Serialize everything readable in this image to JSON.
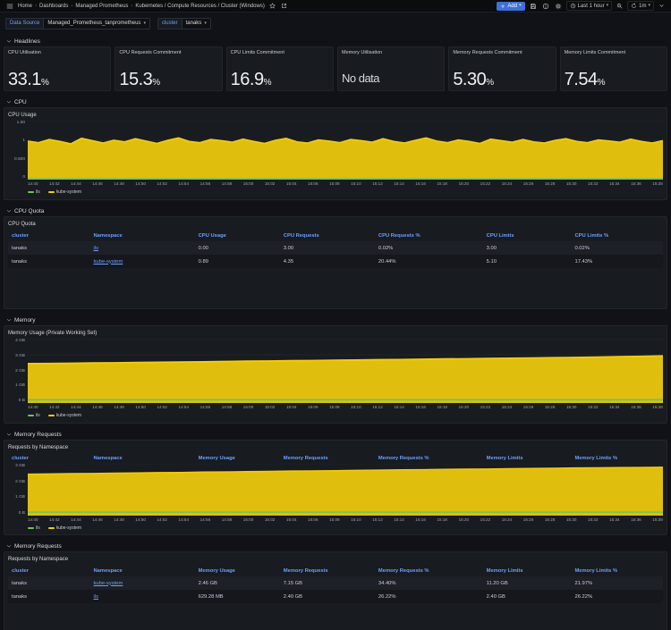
{
  "nav": {
    "breadcrumb": [
      "Home",
      "Dashboards",
      "Managed Prometheus",
      "Kubernetes / Compute Resources / Cluster (Windows)"
    ],
    "add_label": "Add",
    "time_range": "Last 1 hour",
    "refresh_interval": "1m"
  },
  "variables": {
    "datasource_label": "Data Source",
    "datasource_value": "Managed_Prometheus_tanprometheus",
    "cluster_label": "cluster",
    "cluster_value": "tanaks"
  },
  "sections": [
    "Headlines",
    "CPU",
    "CPU Quota",
    "Memory",
    "Memory Requests",
    "Memory Requests"
  ],
  "stats": [
    {
      "title": "CPU Utilisation",
      "value": "33.1",
      "unit": "%"
    },
    {
      "title": "CPU Requests Commitment",
      "value": "15.3",
      "unit": "%"
    },
    {
      "title": "CPU Limits Commitment",
      "value": "16.9",
      "unit": "%"
    },
    {
      "title": "Memory Utilisation",
      "value": "No data",
      "unit": ""
    },
    {
      "title": "Memory Requests Commitment",
      "value": "5.30",
      "unit": "%"
    },
    {
      "title": "Memory Limits Commitment",
      "value": "7.54",
      "unit": "%"
    }
  ],
  "chart_data": [
    {
      "type": "area",
      "title": "CPU Usage",
      "ymax": 1.5,
      "yticks": [
        "1.50",
        "1",
        "0.500",
        "0"
      ],
      "grid_values": [
        0,
        0.5,
        1,
        1.5
      ],
      "x": [
        "14:40",
        "14:42",
        "14:44",
        "14:46",
        "14:48",
        "14:50",
        "14:52",
        "14:54",
        "14:56",
        "14:58",
        "15:00",
        "15:02",
        "15:04",
        "15:06",
        "15:08",
        "15:10",
        "15:12",
        "15:14",
        "15:16",
        "15:18",
        "15:20",
        "15:22",
        "15:24",
        "15:26",
        "15:28",
        "15:30",
        "15:32",
        "15:34",
        "15:36",
        "15:38"
      ],
      "series": [
        {
          "name": "ils",
          "color": "#73bf69",
          "fill": false,
          "values": [
            0.02,
            0.02
          ]
        },
        {
          "name": "kube-system",
          "color": "#f2cc0c",
          "fill": true,
          "values": [
            0.98,
            0.94,
            1.02,
            0.97,
            0.91,
            1.05,
            0.99,
            0.93,
            1.0,
            0.96,
            1.04,
            0.98,
            0.92,
            1.0,
            1.06,
            0.97,
            0.94,
            1.02,
            0.99,
            0.95,
            1.03,
            0.97,
            0.92,
            1.0,
            1.05,
            0.96,
            0.93,
            1.01,
            0.98,
            0.94,
            1.02,
            0.99,
            0.95,
            1.04,
            0.97,
            0.93,
            1.0,
            1.06,
            0.98,
            0.94,
            1.01,
            0.97,
            0.92,
            1.03,
            0.99,
            0.95,
            1.02,
            0.96,
            0.93,
            1.0,
            1.04,
            0.97,
            0.94,
            1.01,
            0.98,
            0.95,
            1.03,
            0.97,
            0.93,
            0.99
          ]
        }
      ]
    },
    {
      "type": "area",
      "title": "Memory Usage (Private Working Set)",
      "ymax": 4,
      "yticks": [
        "4 GB",
        "3 GB",
        "2 GB",
        "1 GB",
        "0 B"
      ],
      "grid_values": [
        0,
        1,
        2,
        3,
        4
      ],
      "x": [
        "14:40",
        "14:42",
        "14:44",
        "14:46",
        "14:48",
        "14:50",
        "14:52",
        "14:54",
        "14:56",
        "14:58",
        "15:00",
        "15:02",
        "15:04",
        "15:06",
        "15:08",
        "15:10",
        "15:12",
        "15:14",
        "15:16",
        "15:18",
        "15:20",
        "15:22",
        "15:24",
        "15:26",
        "15:28",
        "15:30",
        "15:32",
        "15:34",
        "15:36",
        "15:38"
      ],
      "series": [
        {
          "name": "ils",
          "color": "#73bf69",
          "fill": false,
          "values": [
            0.2,
            0.2
          ]
        },
        {
          "name": "kube-system",
          "color": "#f2cc0c",
          "fill": true,
          "values": [
            2.45,
            2.46,
            2.47,
            2.49,
            2.5,
            2.52,
            2.53,
            2.55,
            2.56,
            2.58,
            2.6,
            2.61,
            2.63,
            2.64,
            2.66,
            2.67,
            2.69,
            2.7,
            2.72,
            2.74,
            2.75,
            2.77,
            2.78,
            2.8,
            2.82,
            2.83,
            2.85,
            2.88,
            2.9,
            2.93
          ]
        }
      ]
    },
    {
      "type": "area",
      "title": "Requests by Namespace",
      "ymax": 3,
      "yticks": [
        "3 GB",
        "2 GB",
        "1 GB",
        "0 B"
      ],
      "grid_values": [
        0,
        1,
        2,
        3
      ],
      "x": [
        "14:40",
        "14:42",
        "14:44",
        "14:46",
        "14:48",
        "14:50",
        "14:52",
        "14:54",
        "14:56",
        "14:58",
        "15:00",
        "15:02",
        "15:04",
        "15:06",
        "15:08",
        "15:10",
        "15:12",
        "15:14",
        "15:16",
        "15:18",
        "15:20",
        "15:22",
        "15:24",
        "15:26",
        "15:28",
        "15:30",
        "15:32",
        "15:34",
        "15:36",
        "15:38"
      ],
      "series": [
        {
          "name": "ils",
          "color": "#73bf69",
          "fill": false,
          "values": [
            0.2,
            0.2
          ]
        },
        {
          "name": "kube-system",
          "color": "#f2cc0c",
          "fill": true,
          "values": [
            2.4,
            2.41,
            2.43,
            2.44,
            2.46,
            2.47,
            2.49,
            2.5,
            2.52,
            2.53,
            2.55,
            2.56,
            2.58,
            2.59,
            2.6,
            2.62,
            2.63,
            2.65,
            2.66,
            2.68,
            2.69,
            2.7,
            2.72,
            2.73,
            2.74,
            2.76,
            2.77,
            2.78,
            2.79,
            2.8
          ]
        }
      ]
    }
  ],
  "tables": {
    "cpu_quota": {
      "title": "CPU Quota",
      "columns": [
        "cluster",
        "Namespace",
        "CPU Usage",
        "CPU Requests",
        "CPU Requests %",
        "CPU Limits",
        "CPU Limits %"
      ],
      "rows": [
        [
          "tanaks",
          "ils",
          "0.00",
          "3.00",
          "0.02%",
          "3.00",
          "0.02%"
        ],
        [
          "tanaks",
          "kube-system",
          "0.89",
          "4.35",
          "20.44%",
          "5.10",
          "17.43%"
        ]
      ]
    },
    "requests_header": {
      "columns": [
        "cluster",
        "Namespace",
        "Memory Usage",
        "Memory Requests",
        "Memory Requests %",
        "Memory Limits",
        "Memory Limits %"
      ],
      "rows": []
    },
    "memory_requests": {
      "title": "Requests by Namespace",
      "columns": [
        "cluster",
        "Namespace",
        "Memory Usage",
        "Memory Requests",
        "Memory Requests %",
        "Memory Limits",
        "Memory Limits %"
      ],
      "rows": [
        [
          "tanaks",
          "kube-system",
          "2.46 GB",
          "7.15 GB",
          "34.40%",
          "11.20 GB",
          "21.97%"
        ],
        [
          "tanaks",
          "ils",
          "629.28 MB",
          "2.40 GB",
          "26.22%",
          "2.40 GB",
          "26.22%"
        ]
      ]
    }
  },
  "colors": {
    "yellow": "#f2cc0c",
    "green": "#73bf69",
    "blue": "#6e9fff",
    "accent": "#3d71d9"
  }
}
